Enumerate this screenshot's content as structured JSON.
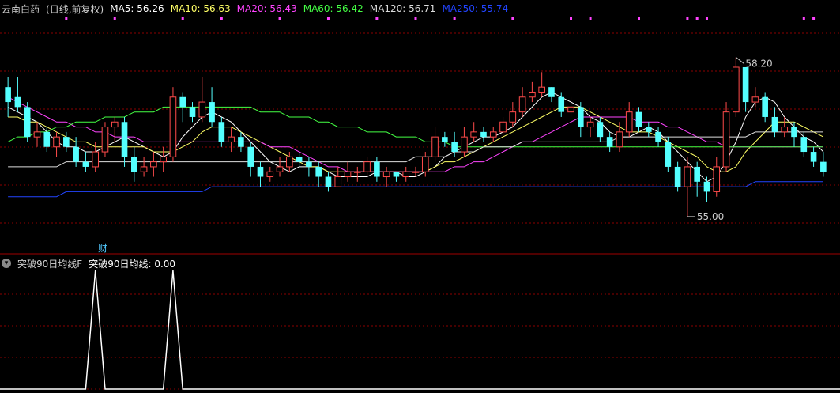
{
  "legend_top": {
    "stock_name": "云南白药",
    "period": "(日线,前复权)",
    "ma_items": [
      {
        "label": "MA5: 56.26",
        "color": "#ffffff"
      },
      {
        "label": "MA10: 56.63",
        "color": "#ffff66"
      },
      {
        "label": "MA20: 56.43",
        "color": "#ff44ff"
      },
      {
        "label": "MA60: 56.42",
        "color": "#44ff44"
      },
      {
        "label": "MA120: 56.71",
        "color": "#dddddd"
      },
      {
        "label": "MA250: 55.74",
        "color": "#2244ff"
      }
    ]
  },
  "legend_bottom": {
    "indicator_name": "突破90日均线F",
    "indicator_value": "突破90日均线: 0.00"
  },
  "badge": "财",
  "colors": {
    "up": "#ff4b4b",
    "down": "#54ffff",
    "grid": "#8b0000",
    "indicator": "#ffffff",
    "signal_dot": "#ff44ff"
  },
  "chart_data": {
    "type": "candlestick",
    "ylim": [
      54.3,
      59.0
    ],
    "max_label": "58.20",
    "min_label": "55.00",
    "candles": [
      [
        57.6,
        57.3,
        57.8,
        57.0
      ],
      [
        57.4,
        57.2,
        57.8,
        57.1
      ],
      [
        57.2,
        56.6,
        57.3,
        56.5
      ],
      [
        56.6,
        56.7,
        56.9,
        56.4
      ],
      [
        56.7,
        56.4,
        56.8,
        56.3
      ],
      [
        56.4,
        56.6,
        56.7,
        56.2
      ],
      [
        56.6,
        56.4,
        56.7,
        56.3
      ],
      [
        56.4,
        56.1,
        56.6,
        56.0
      ],
      [
        56.1,
        56.0,
        56.3,
        55.9
      ],
      [
        56.0,
        56.3,
        56.5,
        55.9
      ],
      [
        56.3,
        56.8,
        56.9,
        56.2
      ],
      [
        56.8,
        56.9,
        57.0,
        56.5
      ],
      [
        56.9,
        56.2,
        57.0,
        56.0
      ],
      [
        56.2,
        55.9,
        56.4,
        55.7
      ],
      [
        55.9,
        56.0,
        56.2,
        55.8
      ],
      [
        56.0,
        56.1,
        56.3,
        55.8
      ],
      [
        56.1,
        56.2,
        56.4,
        55.9
      ],
      [
        56.2,
        57.4,
        57.6,
        56.1
      ],
      [
        57.4,
        57.2,
        57.5,
        56.9
      ],
      [
        57.2,
        57.0,
        57.3,
        56.9
      ],
      [
        57.0,
        57.3,
        57.8,
        56.9
      ],
      [
        57.3,
        56.9,
        57.6,
        56.8
      ],
      [
        56.9,
        56.5,
        57.0,
        56.4
      ],
      [
        56.5,
        56.6,
        56.8,
        56.3
      ],
      [
        56.6,
        56.4,
        56.7,
        56.3
      ],
      [
        56.4,
        56.0,
        56.5,
        55.8
      ],
      [
        56.0,
        55.8,
        56.1,
        55.6
      ],
      [
        55.8,
        55.9,
        56.0,
        55.7
      ],
      [
        55.9,
        56.0,
        56.2,
        55.8
      ],
      [
        56.0,
        56.2,
        56.3,
        55.9
      ],
      [
        56.2,
        56.1,
        56.3,
        56.0
      ],
      [
        56.1,
        56.0,
        56.2,
        55.8
      ],
      [
        56.0,
        55.8,
        56.1,
        55.6
      ],
      [
        55.8,
        55.6,
        55.9,
        55.5
      ],
      [
        55.6,
        55.8,
        56.0,
        55.6
      ],
      [
        55.8,
        55.9,
        56.1,
        55.7
      ],
      [
        55.9,
        55.9,
        56.0,
        55.7
      ],
      [
        55.9,
        56.1,
        56.2,
        55.8
      ],
      [
        56.1,
        55.8,
        56.2,
        55.7
      ],
      [
        55.8,
        55.9,
        56.0,
        55.6
      ],
      [
        55.9,
        55.8,
        55.9,
        55.7
      ],
      [
        55.8,
        55.9,
        56.0,
        55.7
      ],
      [
        55.9,
        55.9,
        56.0,
        55.8
      ],
      [
        55.9,
        56.2,
        56.3,
        55.8
      ],
      [
        56.2,
        56.6,
        56.8,
        56.1
      ],
      [
        56.6,
        56.5,
        56.7,
        56.4
      ],
      [
        56.5,
        56.3,
        56.7,
        56.2
      ],
      [
        56.3,
        56.6,
        56.8,
        56.2
      ],
      [
        56.6,
        56.7,
        56.9,
        56.5
      ],
      [
        56.7,
        56.6,
        56.8,
        56.5
      ],
      [
        56.6,
        56.7,
        56.8,
        56.5
      ],
      [
        56.7,
        56.9,
        57.0,
        56.6
      ],
      [
        56.9,
        57.1,
        57.3,
        56.8
      ],
      [
        57.1,
        57.4,
        57.6,
        57.0
      ],
      [
        57.4,
        57.5,
        57.7,
        57.3
      ],
      [
        57.5,
        57.6,
        57.9,
        57.4
      ],
      [
        57.6,
        57.4,
        57.6,
        57.3
      ],
      [
        57.4,
        57.1,
        57.5,
        57.0
      ],
      [
        57.1,
        57.2,
        57.4,
        57.0
      ],
      [
        57.2,
        56.8,
        57.3,
        56.6
      ],
      [
        56.8,
        56.9,
        57.0,
        56.6
      ],
      [
        56.9,
        56.6,
        57.0,
        56.5
      ],
      [
        56.6,
        56.4,
        56.7,
        56.3
      ],
      [
        56.4,
        56.7,
        56.9,
        56.3
      ],
      [
        56.7,
        57.1,
        57.3,
        56.6
      ],
      [
        57.1,
        56.8,
        57.2,
        56.7
      ],
      [
        56.8,
        56.7,
        56.9,
        56.6
      ],
      [
        56.7,
        56.5,
        56.8,
        56.4
      ],
      [
        56.5,
        56.0,
        56.6,
        55.9
      ],
      [
        56.0,
        55.6,
        56.1,
        55.5
      ],
      [
        55.6,
        56.0,
        56.2,
        55.0
      ],
      [
        56.0,
        55.7,
        56.1,
        55.4
      ],
      [
        55.7,
        55.5,
        55.8,
        55.3
      ],
      [
        55.5,
        56.0,
        56.2,
        55.4
      ],
      [
        56.0,
        57.1,
        57.3,
        55.9
      ],
      [
        57.1,
        58.0,
        58.2,
        57.0
      ],
      [
        58.0,
        57.3,
        58.0,
        57.1
      ],
      [
        57.3,
        57.4,
        57.6,
        57.2
      ],
      [
        57.4,
        57.0,
        57.5,
        56.9
      ],
      [
        57.0,
        56.7,
        57.2,
        56.6
      ],
      [
        56.7,
        56.8,
        57.0,
        56.6
      ],
      [
        56.8,
        56.6,
        56.9,
        56.4
      ],
      [
        56.6,
        56.3,
        56.7,
        56.2
      ],
      [
        56.3,
        56.1,
        56.4,
        56.0
      ],
      [
        56.1,
        55.9,
        56.3,
        55.8
      ]
    ],
    "ma_series": [
      {
        "name": "MA5",
        "color": "#ffffff",
        "values": [
          57.2,
          57.1,
          57.0,
          56.9,
          56.7,
          56.5,
          56.4,
          56.4,
          56.3,
          56.3,
          56.4,
          56.5,
          56.6,
          56.5,
          56.4,
          56.3,
          56.2,
          56.3,
          56.6,
          56.8,
          57.0,
          57.1,
          57.0,
          56.9,
          56.7,
          56.5,
          56.3,
          56.1,
          56.0,
          55.9,
          56.0,
          56.0,
          56.0,
          55.9,
          55.8,
          55.8,
          55.8,
          55.8,
          55.9,
          55.9,
          55.9,
          55.8,
          55.8,
          55.9,
          56.0,
          56.2,
          56.3,
          56.4,
          56.5,
          56.6,
          56.6,
          56.7,
          56.8,
          57.0,
          57.2,
          57.4,
          57.5,
          57.4,
          57.3,
          57.2,
          57.0,
          56.9,
          56.7,
          56.6,
          56.6,
          56.7,
          56.8,
          56.7,
          56.5,
          56.3,
          56.1,
          55.9,
          55.7,
          55.8,
          56.1,
          56.5,
          57.0,
          57.3,
          57.4,
          57.3,
          57.0,
          56.8,
          56.6,
          56.5,
          56.3
        ]
      },
      {
        "name": "MA10",
        "color": "#ffff66",
        "values": [
          57.0,
          57.0,
          56.9,
          56.9,
          56.8,
          56.7,
          56.6,
          56.5,
          56.5,
          56.4,
          56.4,
          56.4,
          56.4,
          56.4,
          56.4,
          56.3,
          56.3,
          56.3,
          56.4,
          56.5,
          56.7,
          56.8,
          56.8,
          56.8,
          56.7,
          56.6,
          56.5,
          56.4,
          56.3,
          56.2,
          56.1,
          56.0,
          56.0,
          55.9,
          55.9,
          55.9,
          55.9,
          55.9,
          55.9,
          55.9,
          55.9,
          55.9,
          55.9,
          55.9,
          56.0,
          56.1,
          56.1,
          56.2,
          56.3,
          56.4,
          56.5,
          56.6,
          56.7,
          56.8,
          56.9,
          57.0,
          57.1,
          57.2,
          57.2,
          57.2,
          57.1,
          57.0,
          56.9,
          56.8,
          56.7,
          56.7,
          56.7,
          56.6,
          56.5,
          56.4,
          56.3,
          56.2,
          56.0,
          55.9,
          55.9,
          56.0,
          56.3,
          56.5,
          56.7,
          56.9,
          56.9,
          56.9,
          56.8,
          56.7,
          56.6
        ]
      },
      {
        "name": "MA20",
        "color": "#ff44ff",
        "values": [
          57.4,
          57.3,
          57.2,
          57.1,
          57.0,
          56.9,
          56.9,
          56.8,
          56.8,
          56.7,
          56.7,
          56.6,
          56.6,
          56.6,
          56.5,
          56.5,
          56.5,
          56.5,
          56.5,
          56.5,
          56.5,
          56.5,
          56.5,
          56.5,
          56.5,
          56.5,
          56.5,
          56.4,
          56.4,
          56.4,
          56.3,
          56.2,
          56.1,
          56.0,
          56.0,
          55.9,
          55.9,
          55.9,
          55.9,
          55.9,
          55.9,
          55.9,
          55.9,
          55.9,
          55.9,
          55.9,
          56.0,
          56.0,
          56.1,
          56.1,
          56.2,
          56.3,
          56.4,
          56.5,
          56.5,
          56.6,
          56.7,
          56.8,
          56.9,
          57.0,
          57.0,
          57.0,
          57.0,
          57.0,
          57.0,
          56.9,
          56.9,
          56.9,
          56.8,
          56.8,
          56.7,
          56.6,
          56.5,
          56.5,
          56.4,
          56.4,
          56.4,
          56.4,
          56.4,
          56.4,
          56.4,
          56.4,
          56.4,
          56.4,
          56.4
        ]
      },
      {
        "name": "MA60",
        "color": "#44ff44",
        "values": [
          56.5,
          56.6,
          56.6,
          56.7,
          56.7,
          56.8,
          56.8,
          56.9,
          56.9,
          56.9,
          57.0,
          57.0,
          57.0,
          57.1,
          57.1,
          57.1,
          57.2,
          57.2,
          57.2,
          57.2,
          57.2,
          57.2,
          57.2,
          57.2,
          57.2,
          57.2,
          57.1,
          57.1,
          57.1,
          57.0,
          57.0,
          57.0,
          56.9,
          56.9,
          56.8,
          56.8,
          56.8,
          56.7,
          56.7,
          56.7,
          56.6,
          56.6,
          56.6,
          56.5,
          56.5,
          56.5,
          56.4,
          56.4,
          56.4,
          56.4,
          56.4,
          56.4,
          56.4,
          56.4,
          56.4,
          56.4,
          56.4,
          56.4,
          56.4,
          56.4,
          56.4,
          56.4,
          56.4,
          56.4,
          56.4,
          56.4,
          56.4,
          56.4,
          56.4,
          56.4,
          56.4,
          56.4,
          56.4,
          56.4,
          56.4,
          56.4,
          56.4,
          56.4,
          56.4,
          56.4,
          56.4,
          56.4,
          56.4,
          56.4,
          56.4
        ]
      },
      {
        "name": "MA120",
        "color": "#dddddd",
        "values": [
          56.0,
          56.0,
          56.0,
          56.0,
          56.0,
          56.0,
          56.1,
          56.1,
          56.1,
          56.1,
          56.1,
          56.1,
          56.1,
          56.1,
          56.1,
          56.1,
          56.1,
          56.1,
          56.1,
          56.1,
          56.1,
          56.1,
          56.1,
          56.1,
          56.1,
          56.1,
          56.1,
          56.1,
          56.1,
          56.1,
          56.1,
          56.1,
          56.1,
          56.1,
          56.1,
          56.1,
          56.1,
          56.1,
          56.1,
          56.1,
          56.1,
          56.1,
          56.2,
          56.2,
          56.2,
          56.2,
          56.3,
          56.3,
          56.3,
          56.4,
          56.4,
          56.4,
          56.4,
          56.5,
          56.5,
          56.5,
          56.5,
          56.5,
          56.5,
          56.5,
          56.5,
          56.5,
          56.5,
          56.6,
          56.6,
          56.6,
          56.6,
          56.6,
          56.6,
          56.6,
          56.6,
          56.6,
          56.6,
          56.6,
          56.6,
          56.6,
          56.6,
          56.7,
          56.7,
          56.7,
          56.7,
          56.7,
          56.7,
          56.7,
          56.7
        ]
      },
      {
        "name": "MA250",
        "color": "#2244ff",
        "values": [
          55.4,
          55.4,
          55.4,
          55.4,
          55.4,
          55.4,
          55.5,
          55.5,
          55.5,
          55.5,
          55.5,
          55.5,
          55.5,
          55.5,
          55.5,
          55.5,
          55.5,
          55.5,
          55.5,
          55.5,
          55.5,
          55.6,
          55.6,
          55.6,
          55.6,
          55.6,
          55.6,
          55.6,
          55.6,
          55.6,
          55.6,
          55.6,
          55.6,
          55.6,
          55.6,
          55.6,
          55.6,
          55.6,
          55.6,
          55.6,
          55.6,
          55.6,
          55.6,
          55.6,
          55.6,
          55.6,
          55.6,
          55.6,
          55.6,
          55.6,
          55.6,
          55.6,
          55.6,
          55.6,
          55.6,
          55.6,
          55.6,
          55.6,
          55.6,
          55.6,
          55.6,
          55.6,
          55.6,
          55.6,
          55.6,
          55.6,
          55.6,
          55.6,
          55.6,
          55.6,
          55.6,
          55.6,
          55.6,
          55.6,
          55.6,
          55.6,
          55.6,
          55.7,
          55.7,
          55.7,
          55.7,
          55.7,
          55.7,
          55.7,
          55.7
        ]
      }
    ],
    "signal_dot_positions": [
      6,
      11,
      18,
      22,
      28,
      33,
      38,
      42,
      46,
      52,
      58,
      60,
      65,
      70,
      71,
      72,
      82,
      83
    ],
    "indicator": {
      "name": "突破90日均线",
      "ylim": [
        0,
        1
      ],
      "values": [
        0,
        0,
        0,
        0,
        0,
        0,
        0,
        0,
        0,
        1,
        0,
        0,
        0,
        0,
        0,
        0,
        0,
        1,
        0,
        0,
        0,
        0,
        0,
        0,
        0,
        0,
        0,
        0,
        0,
        0,
        0,
        0,
        0,
        0,
        0,
        0,
        0,
        0,
        0,
        0,
        0,
        0,
        0,
        0,
        0,
        0,
        0,
        0,
        0,
        0,
        0,
        0,
        0,
        0,
        0,
        0,
        0,
        0,
        0,
        0,
        0,
        0,
        0,
        0,
        0,
        0,
        0,
        0,
        0,
        0,
        0,
        0,
        0,
        0,
        0,
        0,
        0,
        0,
        0,
        0,
        0,
        0,
        0,
        0,
        0
      ]
    }
  }
}
